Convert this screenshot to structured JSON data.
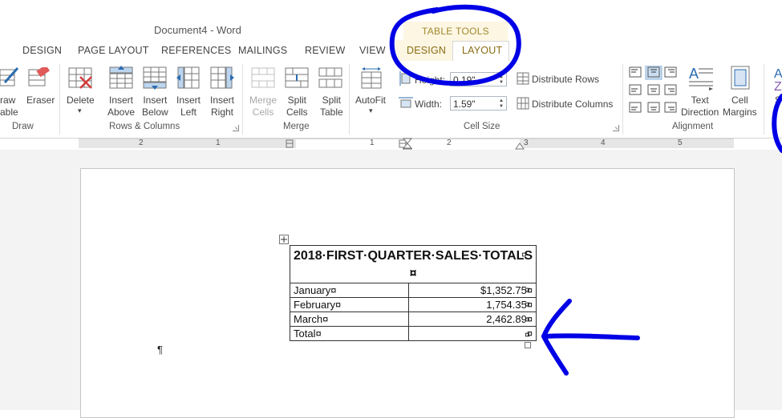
{
  "window": {
    "doc_title": "Document4 - Word",
    "context_group_title": "TABLE TOOLS"
  },
  "tabs": [
    {
      "label": "DESIGN"
    },
    {
      "label": "PAGE LAYOUT"
    },
    {
      "label": "REFERENCES"
    },
    {
      "label": "MAILINGS"
    },
    {
      "label": "REVIEW"
    },
    {
      "label": "VIEW"
    },
    {
      "label": "DESIGN"
    },
    {
      "label": "LAYOUT",
      "active": true
    }
  ],
  "ribbon": {
    "draw": {
      "group": "Draw",
      "draw_table_line1": "raw",
      "draw_table_line2": "able",
      "eraser": "Eraser"
    },
    "rows_cols": {
      "group": "Rows & Columns",
      "delete": "Delete",
      "insert_above": [
        "Insert",
        "Above"
      ],
      "insert_below": [
        "Insert",
        "Below"
      ],
      "insert_left": [
        "Insert",
        "Left"
      ],
      "insert_right": [
        "Insert",
        "Right"
      ]
    },
    "merge": {
      "group": "Merge",
      "merge_cells": [
        "Merge",
        "Cells"
      ],
      "split_cells": [
        "Split",
        "Cells"
      ],
      "split_table": [
        "Split",
        "Table"
      ]
    },
    "cell_size": {
      "group": "Cell Size",
      "autofit": "AutoFit",
      "height_label": "Height:",
      "height_value": "0.19\"",
      "width_label": "Width:",
      "width_value": "1.59\"",
      "distribute_rows": "Distribute Rows",
      "distribute_columns": "Distribute Columns"
    },
    "alignment": {
      "group": "Alignment",
      "text_direction": [
        "Text",
        "Direction"
      ],
      "cell_margins": [
        "Cell",
        "Margins"
      ],
      "partial_label": "S"
    }
  },
  "ruler": {
    "numbers": [
      "2",
      "1",
      "1",
      "2",
      "3",
      "4",
      "5"
    ]
  },
  "table": {
    "title": "2018·FIRST·QUARTER·SALES·TOTALS",
    "end_cell_mark": "¤",
    "rows": [
      {
        "month": "January¤",
        "value": "$1,352.75¤"
      },
      {
        "month": "February¤",
        "value": "1,754.35¤"
      },
      {
        "month": "March¤",
        "value": "2,462.89¤"
      },
      {
        "month": "Total¤",
        "value": "¤"
      }
    ],
    "end_of_row_mark": "¤"
  },
  "paragraph_mark": "¶",
  "annotation": {
    "color": "#0000e6",
    "type": "hand-drawn circle and arrow"
  },
  "icons": [
    "draw-table-icon",
    "eraser-icon",
    "delete-icon",
    "insert-above-icon",
    "insert-below-icon",
    "insert-left-icon",
    "insert-right-icon",
    "merge-cells-icon",
    "split-cells-icon",
    "split-table-icon",
    "autofit-icon",
    "height-icon",
    "width-icon",
    "distribute-rows-icon",
    "distribute-columns-icon",
    "alignment-grid-icons",
    "text-direction-icon",
    "cell-margins-icon",
    "table-move-handle-icon",
    "table-resize-handle-icon"
  ]
}
